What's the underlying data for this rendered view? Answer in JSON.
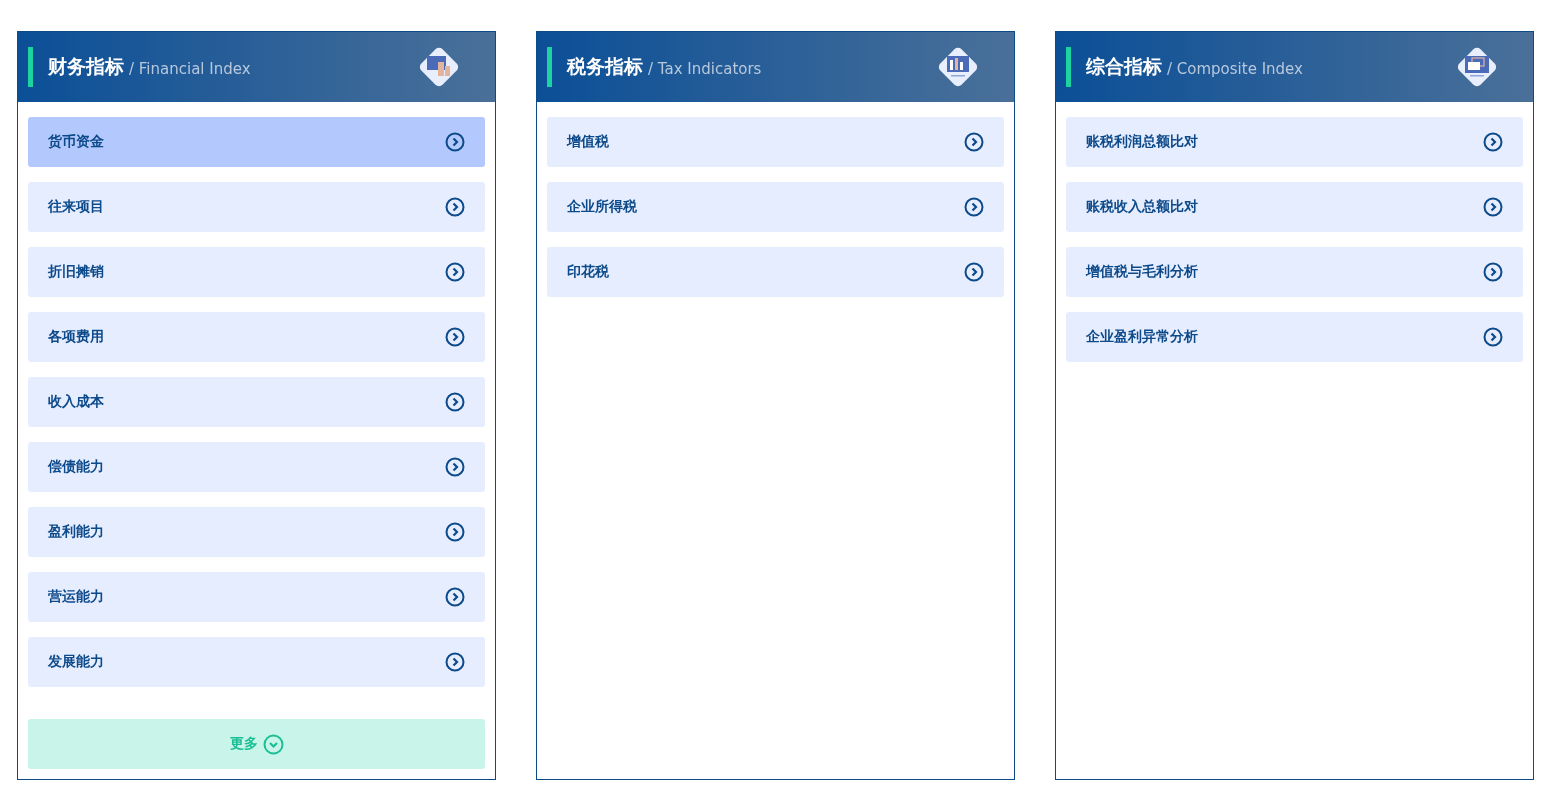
{
  "panels": [
    {
      "title": "财务指标",
      "subtitle": "/ Financial Index",
      "kind": "financial",
      "items": [
        {
          "label": "货币资金",
          "selected": true
        },
        {
          "label": "往来项目",
          "selected": false
        },
        {
          "label": "折旧摊销",
          "selected": false
        },
        {
          "label": "各项费用",
          "selected": false
        },
        {
          "label": "收入成本",
          "selected": false
        },
        {
          "label": "偿债能力",
          "selected": false
        },
        {
          "label": "盈利能力",
          "selected": false
        },
        {
          "label": "营运能力",
          "selected": false
        },
        {
          "label": "发展能力",
          "selected": false
        }
      ],
      "more": "更多"
    },
    {
      "title": "税务指标",
      "subtitle": "/ Tax Indicators",
      "kind": "tax",
      "items": [
        {
          "label": "增值税",
          "selected": false
        },
        {
          "label": "企业所得税",
          "selected": false
        },
        {
          "label": "印花税",
          "selected": false
        }
      ]
    },
    {
      "title": "综合指标",
      "subtitle": "/ Composite Index",
      "kind": "composite",
      "items": [
        {
          "label": "账税利润总额比对",
          "selected": false
        },
        {
          "label": "账税收入总额比对",
          "selected": false
        },
        {
          "label": "增值税与毛利分析",
          "selected": false
        },
        {
          "label": "企业盈利异常分析",
          "selected": false
        }
      ]
    }
  ]
}
